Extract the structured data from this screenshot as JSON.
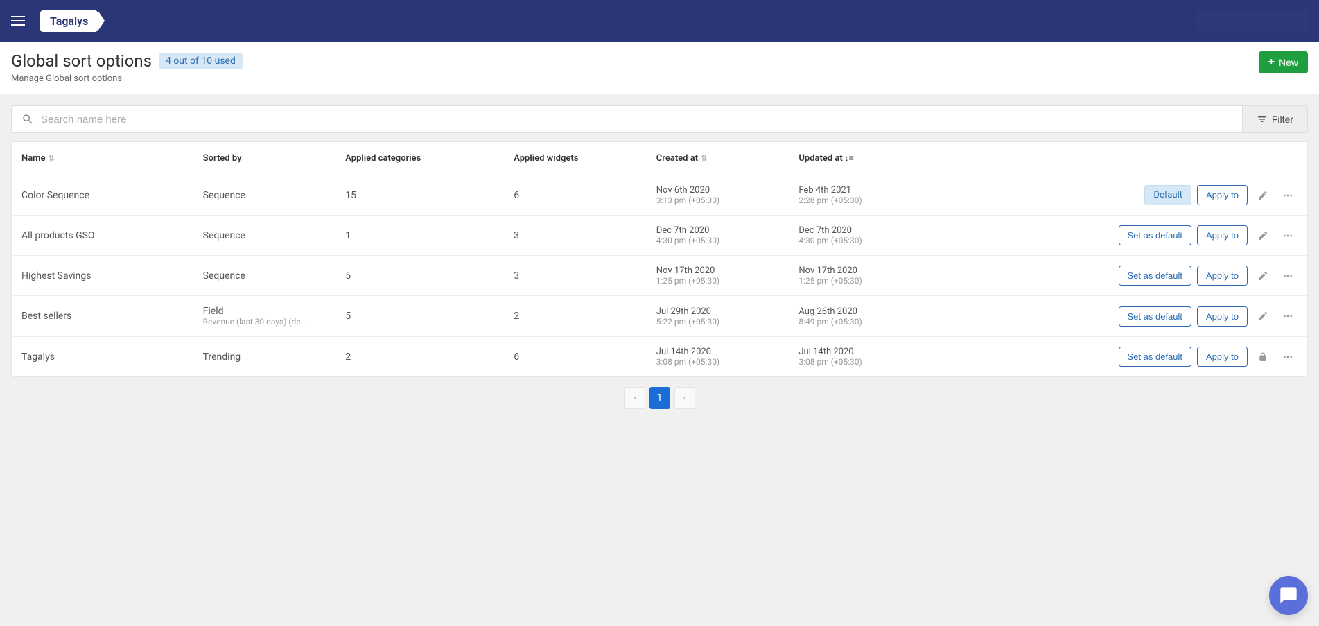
{
  "brand": "Tagalys",
  "header": {
    "title": "Global sort options",
    "usage_badge": "4 out of 10 used",
    "subtitle": "Manage Global sort options",
    "new_button": "New"
  },
  "search": {
    "placeholder": "Search name here",
    "filter_label": "Filter"
  },
  "columns": {
    "name": "Name",
    "sorted_by": "Sorted by",
    "applied_categories": "Applied categories",
    "applied_widgets": "Applied widgets",
    "created_at": "Created at",
    "updated_at": "Updated at"
  },
  "labels": {
    "default": "Default",
    "set_as_default": "Set as default",
    "apply_to": "Apply to"
  },
  "pagination": {
    "current": "1"
  },
  "rows": [
    {
      "name": "Color Sequence",
      "sorted_primary": "Sequence",
      "sorted_secondary": "",
      "categories": "15",
      "widgets": "6",
      "created_date": "Nov 6th 2020",
      "created_time": "3:13 pm (+05:30)",
      "updated_date": "Feb 4th 2021",
      "updated_time": "2:28 pm (+05:30)",
      "is_default": true,
      "locked": false
    },
    {
      "name": "All products GSO",
      "sorted_primary": "Sequence",
      "sorted_secondary": "",
      "categories": "1",
      "widgets": "3",
      "created_date": "Dec 7th 2020",
      "created_time": "4:30 pm (+05:30)",
      "updated_date": "Dec 7th 2020",
      "updated_time": "4:30 pm (+05:30)",
      "is_default": false,
      "locked": false
    },
    {
      "name": "Highest Savings",
      "sorted_primary": "Sequence",
      "sorted_secondary": "",
      "categories": "5",
      "widgets": "3",
      "created_date": "Nov 17th 2020",
      "created_time": "1:25 pm (+05:30)",
      "updated_date": "Nov 17th 2020",
      "updated_time": "1:25 pm (+05:30)",
      "is_default": false,
      "locked": false
    },
    {
      "name": "Best sellers",
      "sorted_primary": "Field",
      "sorted_secondary": "Revenue (last 30 days) (de...",
      "categories": "5",
      "widgets": "2",
      "created_date": "Jul 29th 2020",
      "created_time": "5:22 pm (+05:30)",
      "updated_date": "Aug 26th 2020",
      "updated_time": "8:49 pm (+05:30)",
      "is_default": false,
      "locked": false
    },
    {
      "name": "Tagalys",
      "sorted_primary": "Trending",
      "sorted_secondary": "",
      "categories": "2",
      "widgets": "6",
      "created_date": "Jul 14th 2020",
      "created_time": "3:08 pm (+05:30)",
      "updated_date": "Jul 14th 2020",
      "updated_time": "3:08 pm (+05:30)",
      "is_default": false,
      "locked": true
    }
  ]
}
